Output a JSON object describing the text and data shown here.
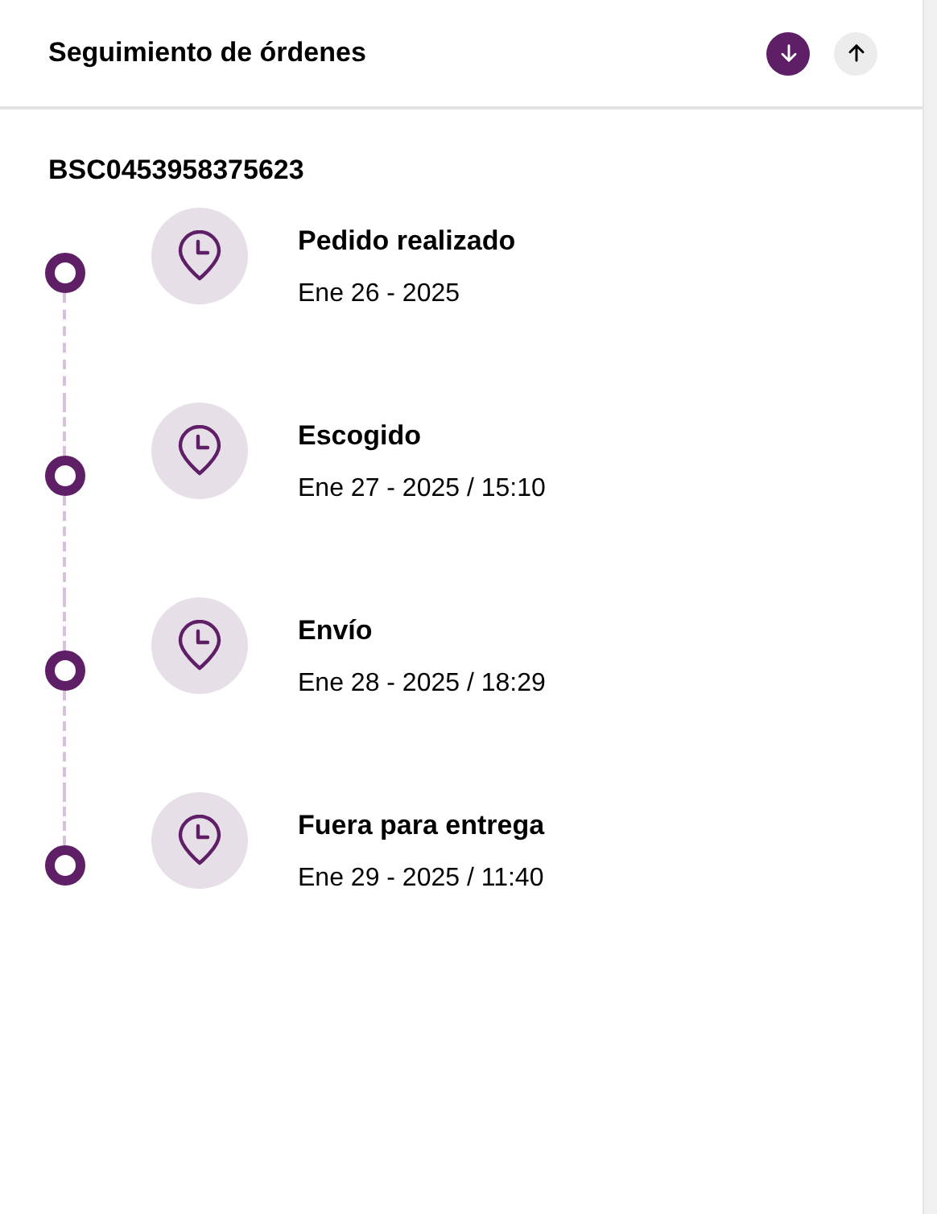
{
  "header": {
    "title": "Seguimiento de órdenes",
    "sort_buttons": [
      {
        "kind": "down",
        "selected": true
      },
      {
        "kind": "up",
        "selected": false
      }
    ]
  },
  "order_id": "BSC0453958375623",
  "events": [
    {
      "title": "Pedido realizado",
      "date": "Ene 26 - 2025"
    },
    {
      "title": "Escogido",
      "date": "Ene 27 - 2025 / 15:10"
    },
    {
      "title": "Envío",
      "date": "Ene 28 - 2025 / 18:29"
    },
    {
      "title": "Fuera para entrega",
      "date": "Ene 29 - 2025 / 11:40"
    }
  ]
}
